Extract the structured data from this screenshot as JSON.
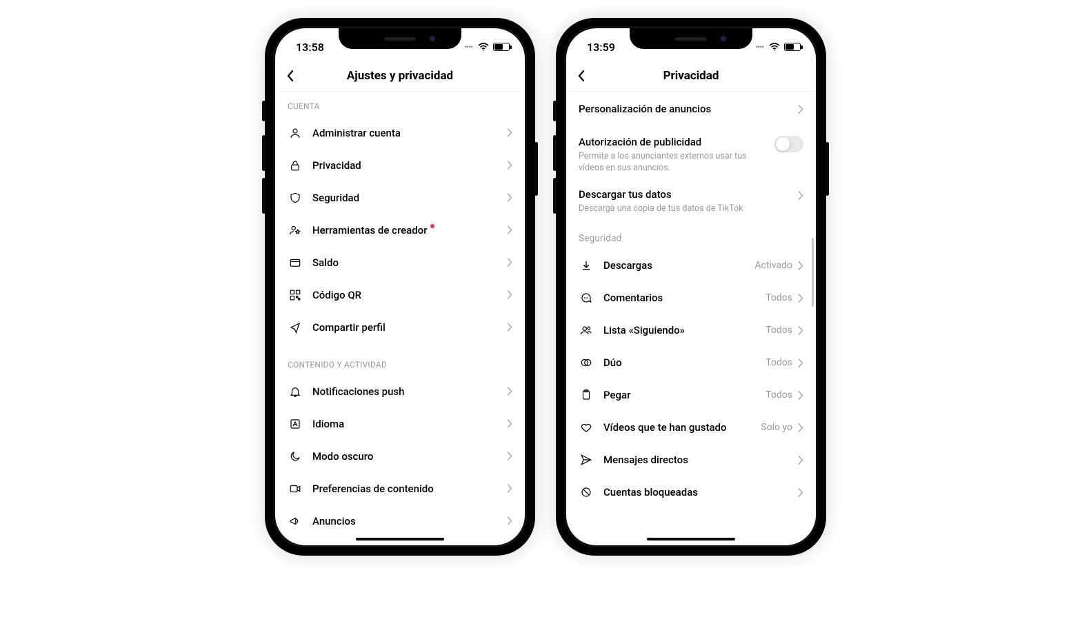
{
  "left": {
    "status_time": "13:58",
    "header_title": "Ajustes y privacidad",
    "section1_title": "CUENTA",
    "rows1": [
      {
        "icon": "user",
        "label": "Administrar cuenta"
      },
      {
        "icon": "lock",
        "label": "Privacidad"
      },
      {
        "icon": "shield",
        "label": "Seguridad"
      },
      {
        "icon": "user-star",
        "label": "Herramientas de creador",
        "badge": true
      },
      {
        "icon": "wallet",
        "label": "Saldo"
      },
      {
        "icon": "qr",
        "label": "Código QR"
      },
      {
        "icon": "share",
        "label": "Compartir perfil"
      }
    ],
    "section2_title": "CONTENIDO Y ACTIVIDAD",
    "rows2": [
      {
        "icon": "bell",
        "label": "Notificaciones push"
      },
      {
        "icon": "lang",
        "label": "Idioma"
      },
      {
        "icon": "moon",
        "label": "Modo oscuro"
      },
      {
        "icon": "video",
        "label": "Preferencias de contenido"
      },
      {
        "icon": "mega",
        "label": "Anuncios"
      }
    ]
  },
  "right": {
    "status_time": "13:59",
    "header_title": "Privacidad",
    "ads_personalization": "Personalización de anuncios",
    "ads_auth_title": "Autorización de publicidad",
    "ads_auth_sub": "Permite a los anunciantes externos usar tus vídeos en sus anuncios.",
    "ads_auth_on": false,
    "download_data_title": "Descargar tus datos",
    "download_data_sub": "Descarga una copia de tus datos de TikTok",
    "section_security": "Seguridad",
    "rows": [
      {
        "icon": "download",
        "label": "Descargas",
        "value": "Activado"
      },
      {
        "icon": "comment",
        "label": "Comentarios",
        "value": "Todos"
      },
      {
        "icon": "users",
        "label": "Lista «Siguiendo»",
        "value": "Todos"
      },
      {
        "icon": "duo",
        "label": "Dúo",
        "value": "Todos"
      },
      {
        "icon": "paste",
        "label": "Pegar",
        "value": "Todos"
      },
      {
        "icon": "heart",
        "label": "Vídeos que te han gustado",
        "value": "Solo yo"
      },
      {
        "icon": "send",
        "label": "Mensajes directos",
        "value": ""
      },
      {
        "icon": "block",
        "label": "Cuentas bloqueadas",
        "value": ""
      }
    ]
  }
}
